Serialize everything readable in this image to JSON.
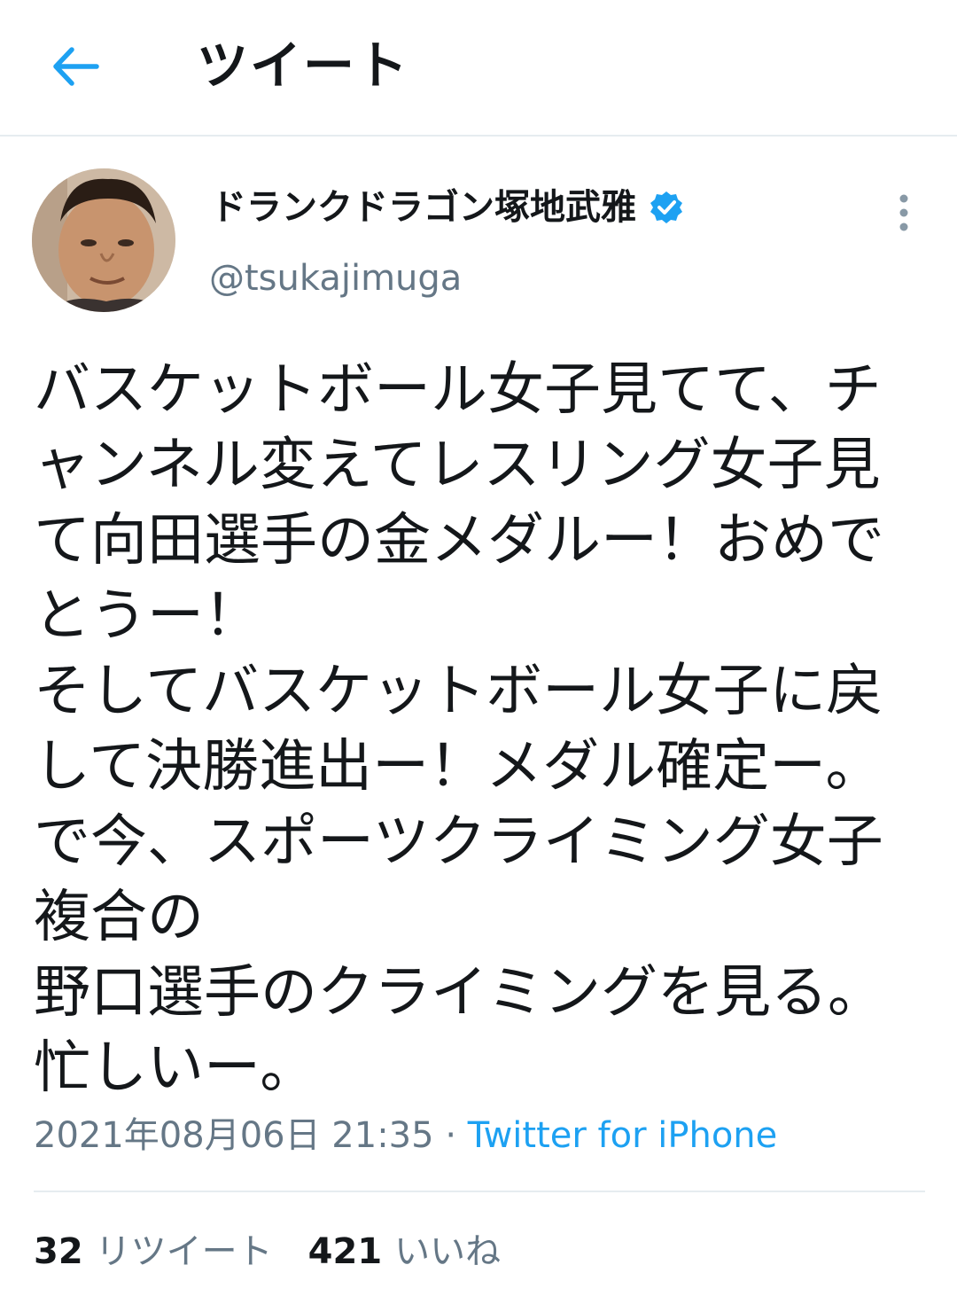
{
  "header": {
    "title": "ツイート",
    "back_icon": "arrow-left-icon",
    "accent_color": "#1da1f2"
  },
  "author": {
    "display_name": "ドランクドラゴン塚地武雅",
    "handle": "@tsukajimuga",
    "verified_icon": "verified-badge-icon",
    "more_icon": "more-vertical-icon"
  },
  "tweet": {
    "lines": [
      "バスケットボール女子見てて、チ",
      "ャンネル変えてレスリング女子見",
      "て向田選手の金メダルー！おめで",
      "とうー！",
      "そしてバスケットボール女子に戻",
      "して決勝進出ー！メダル確定ー。",
      "で今、スポーツクライミング女子",
      "複合の",
      "野口選手のクライミングを見る。",
      "忙しいー。"
    ],
    "timestamp": "2021年08月06日 21:35",
    "separator": "·",
    "source": "Twitter for iPhone"
  },
  "stats": {
    "retweets_count": "32",
    "retweets_label": "リツイート",
    "likes_count": "421",
    "likes_label": "いいね"
  }
}
